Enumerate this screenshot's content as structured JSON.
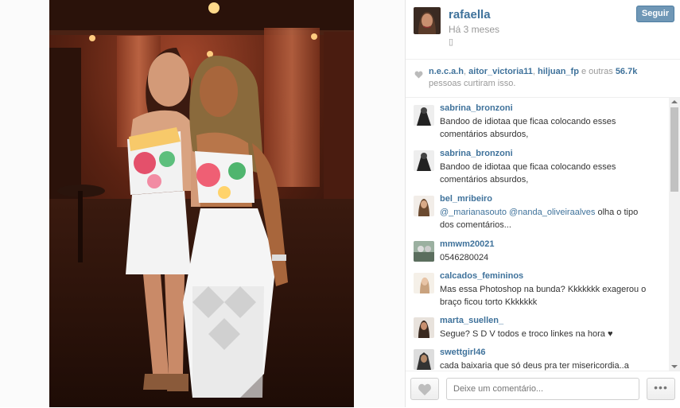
{
  "post": {
    "username": "rafaella",
    "time": "Há 3 meses",
    "small_mark": "▯",
    "follow_label": "Seguir"
  },
  "likes": {
    "users": [
      "n.e.c.a.h",
      "aitor_victoria11",
      "hiljuan_fp"
    ],
    "sep1": ", ",
    "sep2": ", ",
    "rest": " e outras ",
    "count": "56.7k",
    "suffix": " pessoas curtiram isso."
  },
  "comments": [
    {
      "user": "sabrina_bronzoni",
      "text": "Bandoo de idiotaa que ficaa colocando esses comentários absurdos,"
    },
    {
      "user": "sabrina_bronzoni",
      "text": "Bandoo de idiotaa que ficaa colocando esses comentários absurdos,"
    },
    {
      "user": "bel_mribeiro",
      "mention": "@_marianasouto @nanda_oliveiraalves",
      "text": " olha o tipo dos comentários..."
    },
    {
      "user": "mmwm20021",
      "text": "0546280024"
    },
    {
      "user": "calcados_femininos",
      "text": "Mas essa Photoshop na bunda? Kkkkkkk exagerou o braço ficou torto Kkkkkkk"
    },
    {
      "user": "marta_suellen_",
      "text": "Segue? S D V todos e troco linkes na hora ♥"
    },
    {
      "user": "swettgirl46",
      "text": "cada baixaria que só deus pra ter misericordia..a"
    }
  ],
  "footer": {
    "comment_placeholder": "Deixe um comentário...",
    "more_label": "•••"
  },
  "icons": {
    "heart": "heart-icon",
    "more": "more-options-icon"
  },
  "colors": {
    "link": "#3f729b",
    "follow_button": "#6f97b6"
  }
}
